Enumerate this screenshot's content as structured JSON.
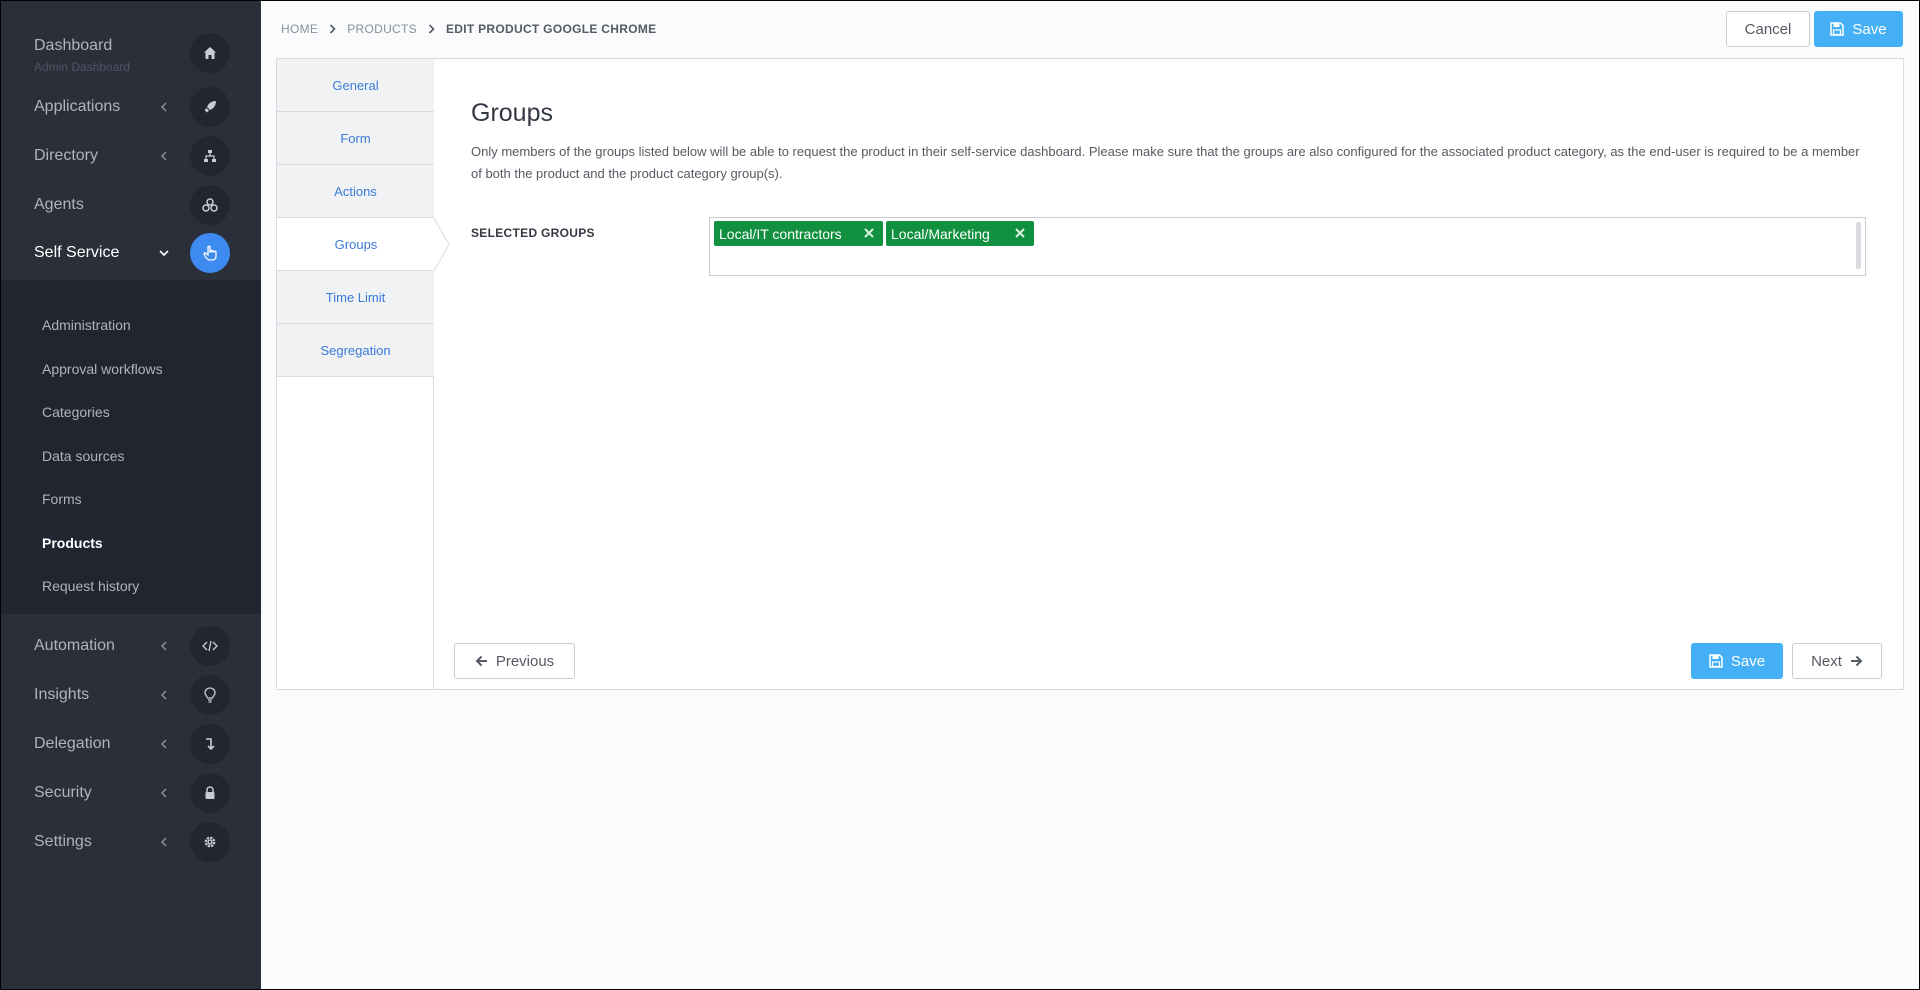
{
  "sidebar": {
    "items": [
      {
        "label": "Dashboard",
        "sublabel": "Admin Dashboard",
        "icon": "home-icon"
      },
      {
        "label": "Applications",
        "icon": "rocket-icon"
      },
      {
        "label": "Directory",
        "icon": "sitemap-icon"
      },
      {
        "label": "Agents",
        "icon": "cubes-icon"
      },
      {
        "label": "Self Service",
        "icon": "hand-pointer-icon",
        "active": true
      },
      {
        "label": "Automation",
        "icon": "code-icon"
      },
      {
        "label": "Insights",
        "icon": "lightbulb-icon"
      },
      {
        "label": "Delegation",
        "icon": "level-down-icon"
      },
      {
        "label": "Security",
        "icon": "lock-icon"
      },
      {
        "label": "Settings",
        "icon": "gear-icon"
      }
    ],
    "submenu": [
      {
        "label": "Administration"
      },
      {
        "label": "Approval workflows"
      },
      {
        "label": "Categories"
      },
      {
        "label": "Data sources"
      },
      {
        "label": "Forms"
      },
      {
        "label": "Products",
        "active": true
      },
      {
        "label": "Request history"
      }
    ]
  },
  "breadcrumb": {
    "home": "HOME",
    "products": "PRODUCTS",
    "current": "EDIT PRODUCT GOOGLE CHROME"
  },
  "header": {
    "cancel_label": "Cancel",
    "save_label": "Save"
  },
  "tabs": [
    {
      "label": "General"
    },
    {
      "label": "Form"
    },
    {
      "label": "Actions"
    },
    {
      "label": "Groups",
      "active": true
    },
    {
      "label": "Time Limit"
    },
    {
      "label": "Segregation"
    }
  ],
  "groups": {
    "title": "Groups",
    "description": "Only members of the groups listed below will be able to request the product in their self-service dashboard. Please make sure that the groups are also configured for the associated product category, as the end-user is required to be a member of both the product and the product category group(s).",
    "field_label": "SELECTED GROUPS",
    "selected": [
      {
        "label": "Local/IT contractors"
      },
      {
        "label": "Local/Marketing"
      }
    ]
  },
  "footer": {
    "previous_label": "Previous",
    "save_label": "Save",
    "next_label": "Next"
  },
  "colors": {
    "sidebar_bg": "#2b2f3a",
    "submenu_bg": "#222530",
    "accent_blue": "#3d8bf0",
    "primary_button": "#45b0f5",
    "tag_green": "#119040",
    "tab_link": "#3a7ad9"
  }
}
